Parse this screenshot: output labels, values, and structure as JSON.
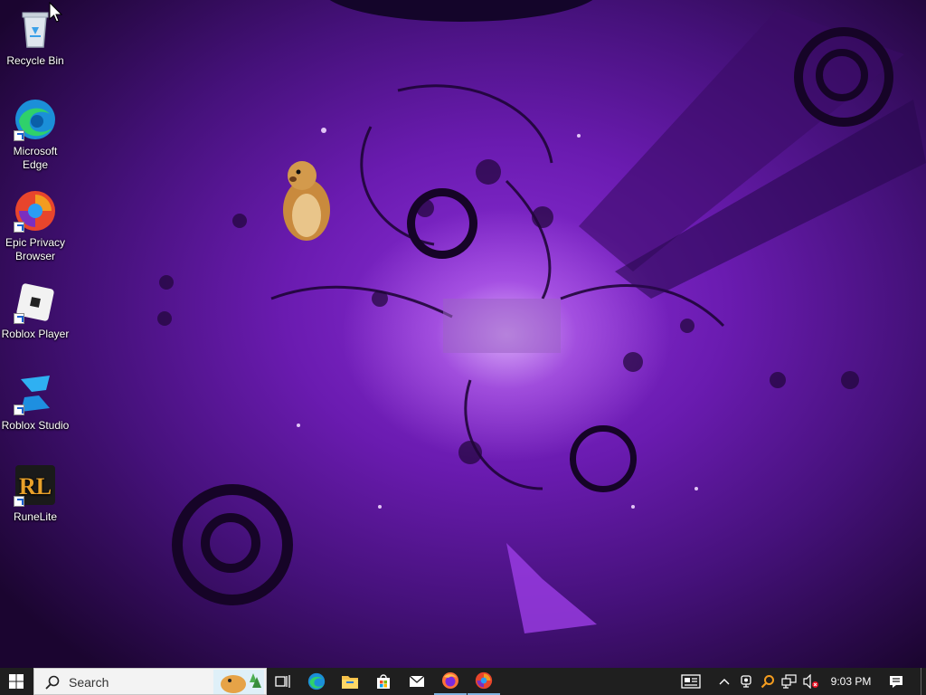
{
  "desktop": {
    "icons": [
      {
        "label": "Recycle Bin",
        "icon": "recycle-bin-icon"
      },
      {
        "label": "Microsoft Edge",
        "icon": "edge-icon"
      },
      {
        "label": "Epic Privacy Browser",
        "icon": "epic-browser-icon"
      },
      {
        "label": "Roblox Player",
        "icon": "roblox-player-icon"
      },
      {
        "label": "Roblox Studio",
        "icon": "roblox-studio-icon"
      },
      {
        "label": "RuneLite",
        "icon": "runelite-icon"
      }
    ],
    "runelite_logo": "RL"
  },
  "taskbar": {
    "search_placeholder": "Search",
    "apps": [
      "task-view-icon",
      "edge-icon",
      "file-explorer-icon",
      "store-icon",
      "mail-icon",
      "firefox-icon",
      "epic-browser-icon"
    ],
    "tray": [
      "news-widget-icon",
      "chevron-up-icon",
      "camera-icon",
      "search-tray-icon",
      "network-icon",
      "volume-muted-icon"
    ],
    "clock": "9:03 PM"
  },
  "colors": {
    "wallpaper_primary": "#6a1bb0",
    "wallpaper_dark": "#160427",
    "taskbar_bg": "#1f1f1f",
    "accent_green": "#2ad13a"
  }
}
